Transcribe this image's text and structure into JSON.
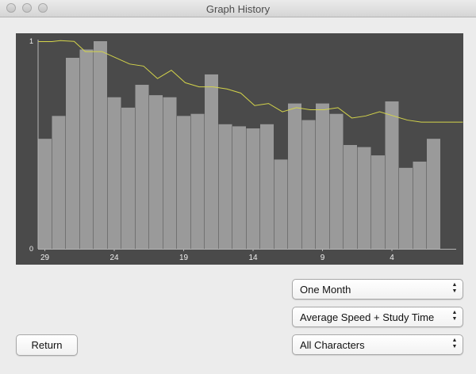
{
  "window": {
    "title": "Graph History"
  },
  "controls": {
    "range_select": "One Month",
    "mode_select": "Average Speed + Study Time",
    "filter_select": "All Characters",
    "return_label": "Return"
  },
  "colors": {
    "chart_background": "#4a4a4a",
    "bar": "#9a9a9a",
    "line": "#d4d44a",
    "axis": "#b5b5b5"
  },
  "chart_data": {
    "type": "bar",
    "title": "",
    "xlabel": "",
    "ylabel": "",
    "ylim": [
      0,
      1
    ],
    "y_ticks": [
      "0",
      "1"
    ],
    "categories": [
      "29",
      "30",
      "31",
      "1",
      "2",
      "3",
      "4",
      "5",
      "6",
      "7",
      "8",
      "9",
      "10",
      "11",
      "12",
      "13",
      "14",
      "15",
      "16",
      "17",
      "18",
      "19",
      "20",
      "21",
      "22",
      "23",
      "24",
      "25",
      "26",
      "27",
      "28"
    ],
    "x_tick_labels": [
      {
        "label": "29",
        "index": 0
      },
      {
        "label": "24",
        "index": 5
      },
      {
        "label": "19",
        "index": 10
      },
      {
        "label": "14",
        "index": 15
      },
      {
        "label": "9",
        "index": 20
      },
      {
        "label": "4",
        "index": 25
      }
    ],
    "series": [
      {
        "type": "bar",
        "values": [
          0.53,
          0.64,
          0.92,
          0.96,
          1.0,
          0.73,
          0.68,
          0.79,
          0.74,
          0.73,
          0.64,
          0.65,
          0.84,
          0.6,
          0.59,
          0.58,
          0.6,
          0.43,
          0.7,
          0.62,
          0.7,
          0.65,
          0.5,
          0.49,
          0.45,
          0.71,
          0.39,
          0.42,
          0.53
        ]
      },
      {
        "type": "line",
        "x": [
          0,
          1,
          1.6,
          2.6,
          3.4,
          4.6,
          5.6,
          6.6,
          7.6,
          8.6,
          9.6,
          10.6,
          11.6,
          12.6,
          13.6,
          14.6,
          15.6,
          16.6,
          17.6,
          18.6,
          19.6,
          20.6,
          21.6,
          22.6,
          23.6,
          24.6,
          25.6,
          26.6,
          27.6,
          28.6,
          29.6,
          30.6
        ],
        "values": [
          0.998,
          0.998,
          1.003,
          0.999,
          0.95,
          0.95,
          0.92,
          0.89,
          0.88,
          0.82,
          0.86,
          0.8,
          0.78,
          0.78,
          0.77,
          0.75,
          0.69,
          0.7,
          0.66,
          0.68,
          0.67,
          0.67,
          0.68,
          0.63,
          0.64,
          0.66,
          0.64,
          0.62,
          0.61,
          0.61,
          0.61,
          0.61
        ]
      }
    ]
  }
}
